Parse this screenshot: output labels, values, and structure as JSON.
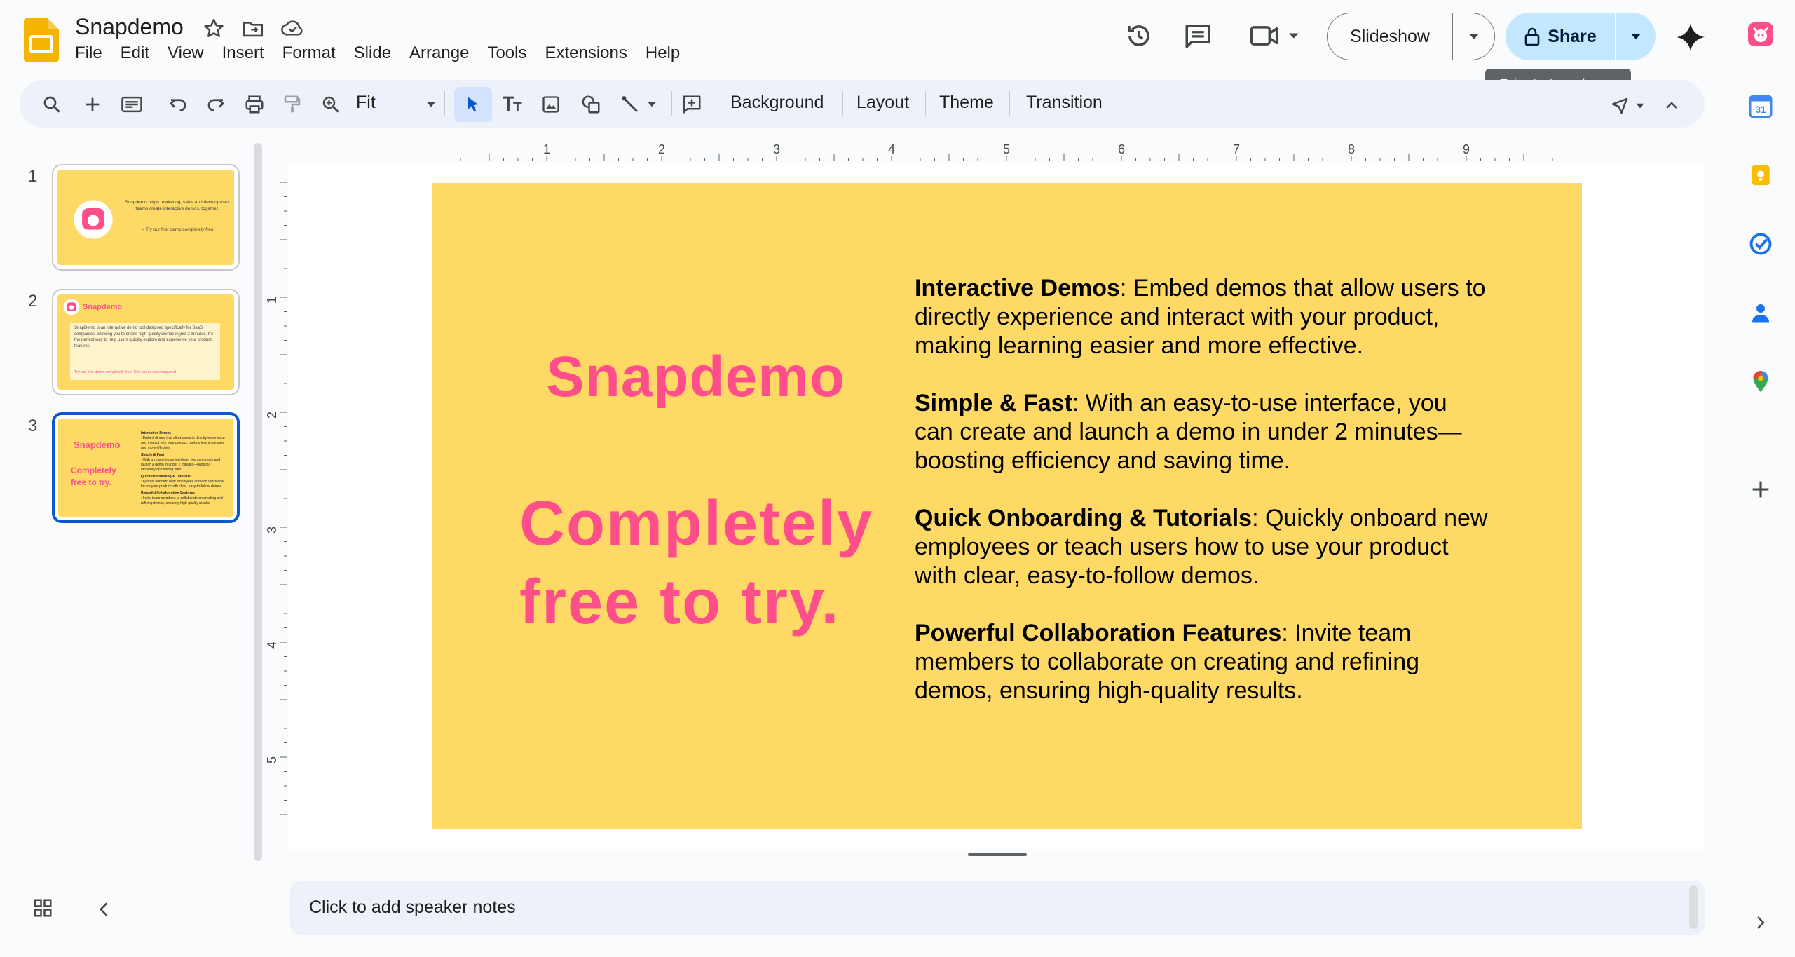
{
  "app": {
    "title": "Snapdemo"
  },
  "menu": [
    "File",
    "Edit",
    "View",
    "Insert",
    "Format",
    "Slide",
    "Arrange",
    "Tools",
    "Extensions",
    "Help"
  ],
  "header": {
    "slideshow_label": "Slideshow",
    "share_label": "Share",
    "tooltip": "Private to only me"
  },
  "toolbar": {
    "zoom_value": "Fit",
    "background_label": "Background",
    "layout_label": "Layout",
    "theme_label": "Theme",
    "transition_label": "Transition"
  },
  "ruler": {
    "horizontal": [
      "1",
      "2",
      "3",
      "4",
      "5",
      "6",
      "7",
      "8",
      "9"
    ],
    "vertical": [
      "1",
      "2",
      "3",
      "4",
      "5"
    ]
  },
  "slides": [
    {
      "number": "1",
      "text": "Snapdemo helps marketing, sales and development teams create interactive demos, together.",
      "cta": "→ Try our first demo completely free!"
    },
    {
      "number": "2",
      "brand": "Snapdemo",
      "text": "SnapDemo is an interactive demo tool designed specifically for SaaS companies, allowing you to create high-quality demos in just 2 minutes. It's the perfect way to help users quickly explore and experience your product features.",
      "cta": "Try our first demo completely free! Use cover-code required"
    },
    {
      "number": "3",
      "heading": "Snapdemo",
      "tagline": "Completely free to try."
    }
  ],
  "current_slide": {
    "heading": "Snapdemo",
    "tagline_line1": "Completely",
    "tagline_line2": "free to try.",
    "sections": [
      {
        "title": "Interactive Demos",
        "text": ": Embed demos that allow users to directly experience and interact with your product, making learning easier and more effective."
      },
      {
        "title": "Simple & Fast",
        "text": ": With an easy-to-use interface, you can create and launch a demo in under 2 minutes—boosting efficiency and saving time."
      },
      {
        "title": "Quick Onboarding & Tutorials",
        "text": ": Quickly onboard new employees or teach users how to use your product with clear, easy-to-follow demos."
      },
      {
        "title": "Powerful Collaboration Features",
        "text": ": Invite team members to collaborate on creating and refining demos, ensuring high-quality results."
      }
    ]
  },
  "notes": {
    "placeholder": "Click to add speaker notes"
  },
  "side_panel": [
    "calendar-icon",
    "keep-icon",
    "tasks-icon",
    "contacts-icon",
    "maps-icon",
    "add-icon"
  ],
  "colors": {
    "slide_bg": "#ffd966",
    "brand_pink": "#ff4f8b",
    "accent_blue": "#0b57d0",
    "share_bg": "#c2e7ff"
  }
}
